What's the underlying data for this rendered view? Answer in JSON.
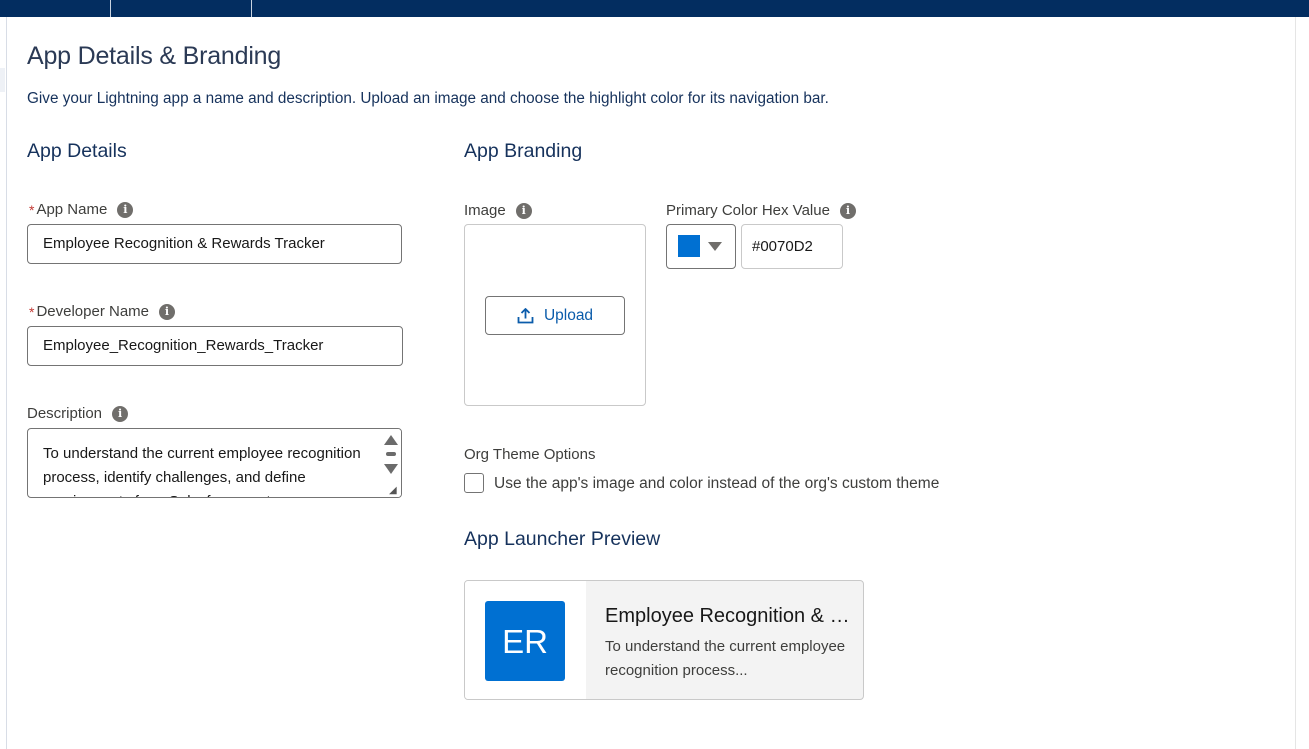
{
  "page": {
    "title": "App Details & Branding",
    "subtitle": "Give your Lightning app a name and description. Upload an image and choose the highlight color for its navigation bar."
  },
  "app_details": {
    "heading": "App Details",
    "app_name": {
      "label": "App Name",
      "required_marker": "*",
      "value": "Employee Recognition & Rewards Tracker"
    },
    "developer_name": {
      "label": "Developer Name",
      "required_marker": "*",
      "value": "Employee_Recognition_Rewards_Tracker"
    },
    "description": {
      "label": "Description",
      "value": "To understand the current employee recognition process, identify challenges, and define requirements for a Salesforce system"
    }
  },
  "app_branding": {
    "heading": "App Branding",
    "image": {
      "label": "Image",
      "upload_label": "Upload"
    },
    "primary_color": {
      "label": "Primary Color Hex Value",
      "value": "#0070D2",
      "swatch_color": "#0070d2"
    },
    "org_theme": {
      "label": "Org Theme Options",
      "checkbox_label": "Use the app's image and color instead of the org's custom theme",
      "checked": false
    }
  },
  "preview": {
    "heading": "App Launcher Preview",
    "initials": "ER",
    "title": "Employee Recognition & R...",
    "description": "To understand the current employee recognition process..."
  },
  "icons": {
    "info": "info-icon",
    "upload": "upload-icon",
    "caret": "chevron-down-icon"
  },
  "colors": {
    "top_bar": "#032d60",
    "accent": "#0070d2",
    "link": "#0b5cab",
    "required": "#c23934"
  }
}
